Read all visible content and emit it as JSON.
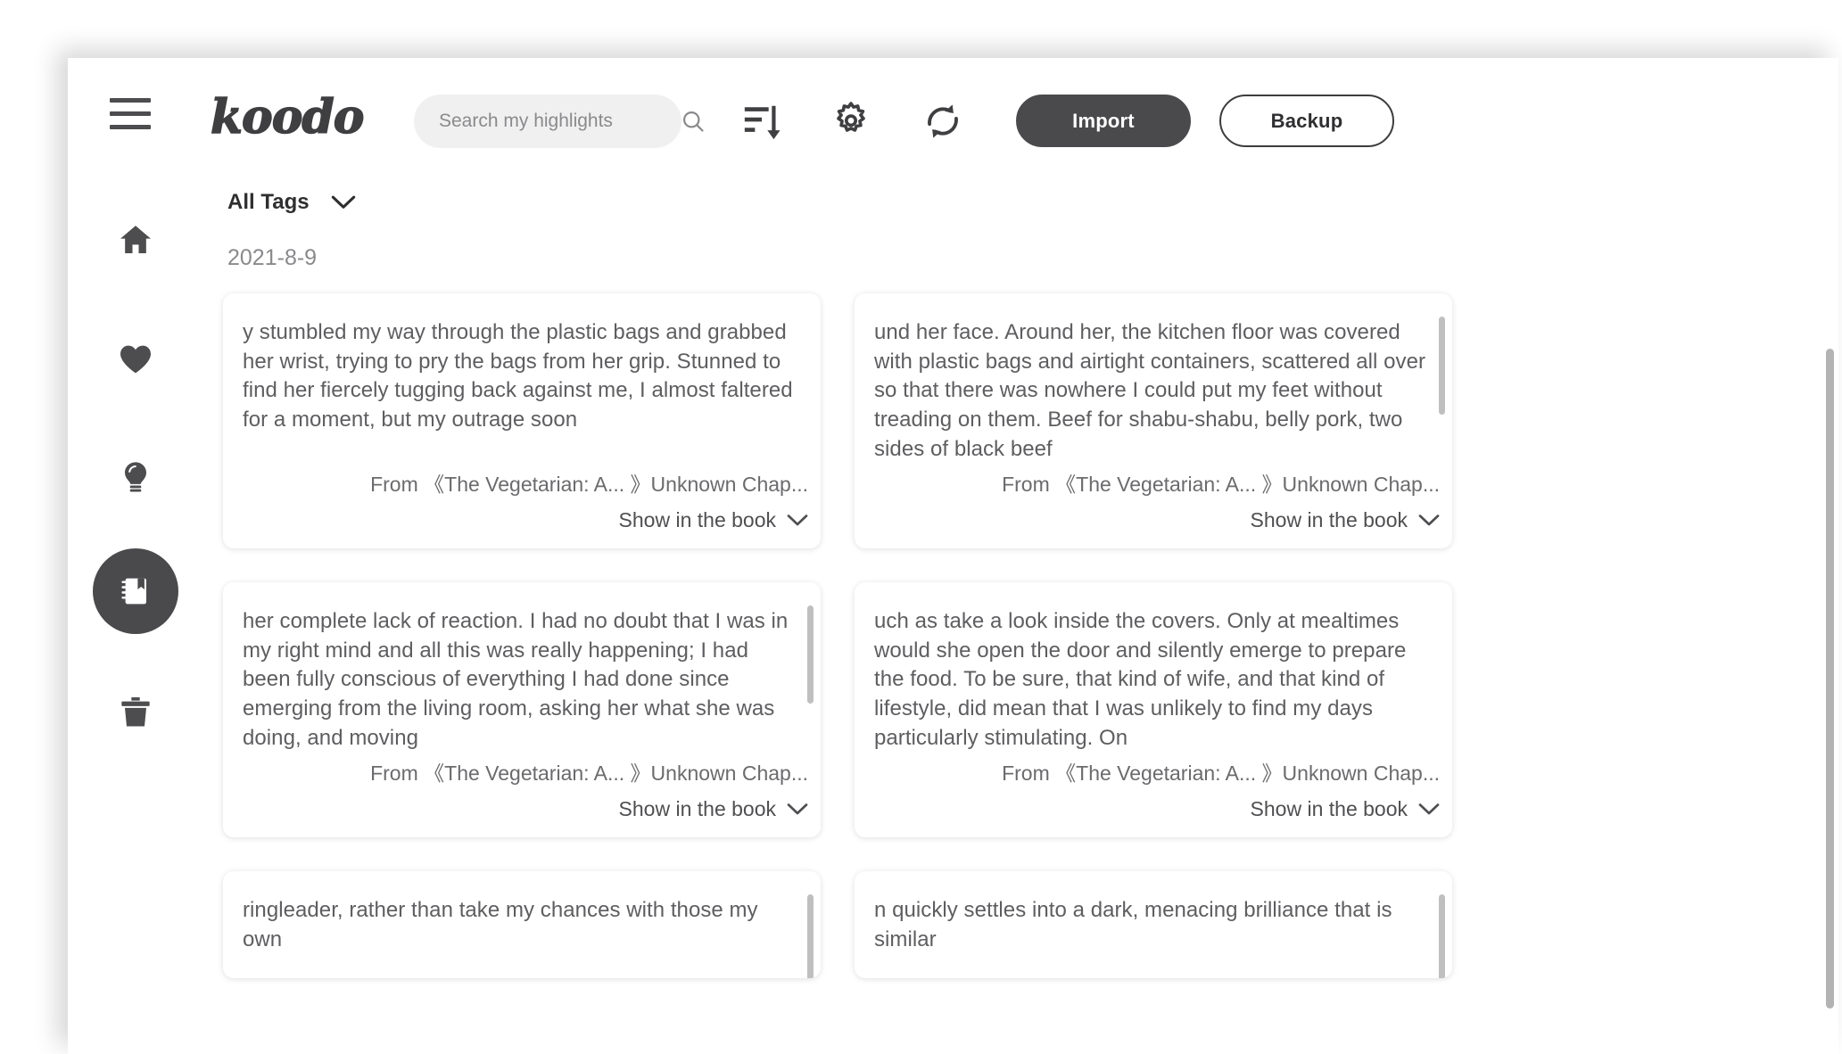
{
  "app": {
    "logo": "koodo"
  },
  "header": {
    "menu_icon": "hamburger-icon",
    "search": {
      "placeholder": "Search my highlights",
      "value": "",
      "icon": "search-icon"
    },
    "icons": [
      {
        "name": "sort-icon",
        "title": "Sort"
      },
      {
        "name": "gear-icon",
        "title": "Settings"
      },
      {
        "name": "sync-icon",
        "title": "Sync"
      }
    ],
    "import_label": "Import",
    "backup_label": "Backup"
  },
  "sidebar": {
    "items": [
      {
        "icon": "home-icon",
        "name": "home",
        "active": false
      },
      {
        "icon": "heart-icon",
        "name": "favorites",
        "active": false
      },
      {
        "icon": "lightbulb-icon",
        "name": "ideas",
        "active": false
      },
      {
        "icon": "notebook-icon",
        "name": "highlights",
        "active": true
      },
      {
        "icon": "trash-icon",
        "name": "trash",
        "active": false
      }
    ]
  },
  "main": {
    "tags_filter": "All Tags",
    "date_group": "2021-8-9",
    "cards": [
      {
        "text": "y stumbled my way through the plastic bags and grabbed her wrist, trying to pry the bags from her grip. Stunned to find her fiercely tugging back against me, I almost faltered for a moment, but my outrage soon",
        "from": "From 《The Vegetarian: A... 》Unknown Chap...",
        "show": "Show in the book",
        "has_scrollbar": false
      },
      {
        "text": "und her face. Around her, the kitchen floor was covered with plastic bags and airtight containers, scattered all over so that there was nowhere I could put my feet without treading on them. Beef for shabu-shabu, belly pork, two sides of black beef",
        "from": "From 《The Vegetarian: A... 》Unknown Chap...",
        "show": "Show in the book",
        "has_scrollbar": true
      },
      {
        "text": "her complete lack of reaction. I had no doubt that I was in my right mind and all this was really happening; I had been fully conscious of everything I had done since emerging from the living room, asking her what she was doing, and moving",
        "from": "From 《The Vegetarian: A... 》Unknown Chap...",
        "show": "Show in the book",
        "has_scrollbar": true
      },
      {
        "text": "uch as take a look inside the covers. Only at mealtimes would she open the door and silently emerge to prepare the food. To be sure, that kind of wife, and that kind of lifestyle, did mean that I was unlikely to find my days particularly stimulating. On",
        "from": "From 《The Vegetarian: A... 》Unknown Chap...",
        "show": "Show in the book",
        "has_scrollbar": false
      }
    ],
    "cards_partial": [
      {
        "text": "ringleader, rather than take my chances with those my own",
        "has_scrollbar": true
      },
      {
        "text": "n quickly settles into a dark, menacing brilliance that is similar",
        "has_scrollbar": true
      }
    ]
  },
  "colors": {
    "accent_dark": "#4a4a4c",
    "text_body": "#5e5e61",
    "muted": "#8a8a8d",
    "search_bg": "#f0f0f0"
  }
}
